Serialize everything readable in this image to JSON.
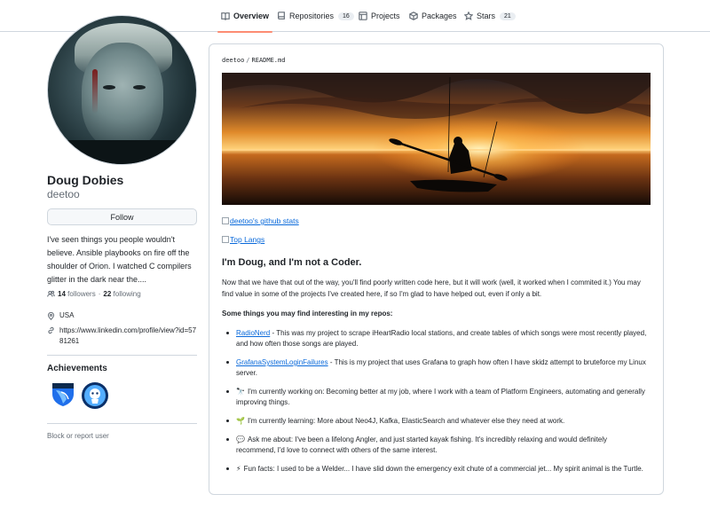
{
  "nav": {
    "tabs": [
      {
        "label": "Overview",
        "count": ""
      },
      {
        "label": "Repositories",
        "count": "16"
      },
      {
        "label": "Projects",
        "count": ""
      },
      {
        "label": "Packages",
        "count": ""
      },
      {
        "label": "Stars",
        "count": "21"
      }
    ],
    "active": "Overview",
    "accent": "#fd8c73"
  },
  "profile": {
    "name": "Doug Dobies",
    "login": "deetoo",
    "follow_label": "Follow",
    "bio": "I've seen things you people wouldn't believe. Ansible playbooks on fire off the shoulder of Orion. I watched C compilers glitter in the dark near the....",
    "followers_count": "14",
    "followers_label": "followers",
    "following_count": "22",
    "following_label": "following",
    "location": "USA",
    "website": "https://www.linkedin.com/profile/view?id=5781261",
    "achievements_title": "Achievements",
    "report_label": "Block or report user"
  },
  "readme": {
    "path_user": "deetoo",
    "path_file": "README.md",
    "stats_alt": "deetoo's github stats",
    "langs_alt": "Top Langs",
    "heading": "I'm Doug, and I'm not a Coder.",
    "intro": "Now that we have that out of the way, you'll find poorly written code here, but it will work (well, it worked when I commited it.) You may find value in some of the projects I've created here, if so I'm glad to have helped out, even if only a bit.",
    "interesting_heading": "Some things you may find interesting in my repos:",
    "items": [
      {
        "link": "RadioNerd",
        "text": " - This was my project to scrape iHeartRadio local stations, and create tables of which songs were most recently played, and how often those songs are played."
      },
      {
        "link": "GrafanaSystemLoginFailures",
        "text": " - This is my project that uses Grafana to graph how often I have skidz attempt to bruteforce my Linux server."
      },
      {
        "emoji": "🔭",
        "text": "I'm currently working on: Becoming better at my job, where I work with a team of Platform Engineers, automating and generally improving things."
      },
      {
        "emoji": "🌱",
        "text": "I'm currently learning: More about Neo4J, Kafka, ElasticSearch and whatever else they need at work."
      },
      {
        "emoji": "💬",
        "text": "Ask me about: I've been a lifelong Angler, and just started kayak fishing. It's incredibly relaxing and would definitely recommend, I'd love to connect with others of the same interest."
      },
      {
        "emoji": "⚡",
        "text": "Fun facts: I used to be a Welder... I have slid down the emergency exit chute of a commercial jet... My spirit animal is the Turtle."
      }
    ]
  },
  "colors": {
    "link": "#0969da",
    "border": "#d0d7de",
    "muted": "#656d76",
    "text": "#1f2328"
  }
}
